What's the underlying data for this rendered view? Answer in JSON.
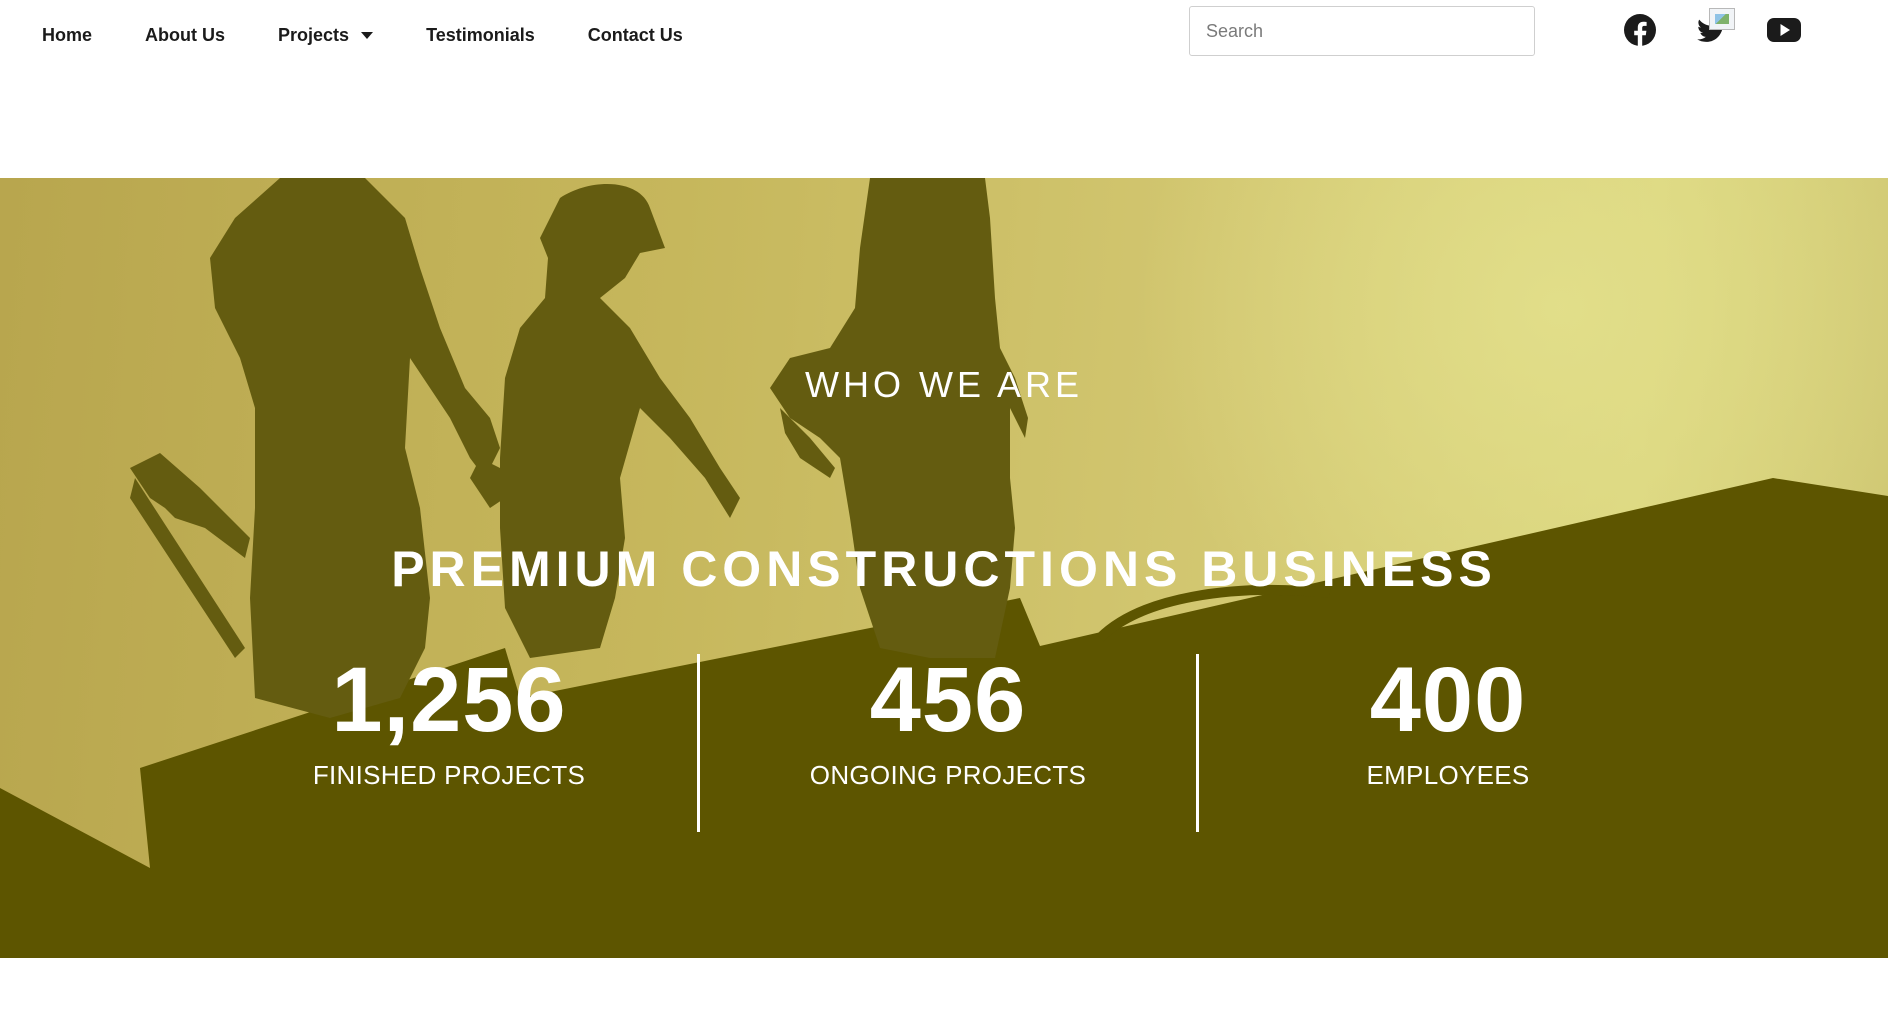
{
  "nav": {
    "items": [
      {
        "label": "Home",
        "has_dropdown": false
      },
      {
        "label": "About Us",
        "has_dropdown": false
      },
      {
        "label": "Projects",
        "has_dropdown": true
      },
      {
        "label": "Testimonials",
        "has_dropdown": false
      },
      {
        "label": "Contact Us",
        "has_dropdown": false
      }
    ]
  },
  "search": {
    "placeholder": "Search",
    "value": ""
  },
  "social": {
    "icons": [
      "facebook-icon",
      "twitter-icon",
      "youtube-icon"
    ],
    "color": "#1b1b1b"
  },
  "hero": {
    "eyebrow": "WHO WE ARE",
    "headline": "PREMIUM CONSTRUCTIONS BUSINESS",
    "overlay_color": "#c9b95f",
    "stats": [
      {
        "value": "1,256",
        "label": "FINISHED PROJECTS"
      },
      {
        "value": "456",
        "label": "ONGOING PROJECTS"
      },
      {
        "value": "400",
        "label": "EMPLOYEES"
      }
    ]
  }
}
